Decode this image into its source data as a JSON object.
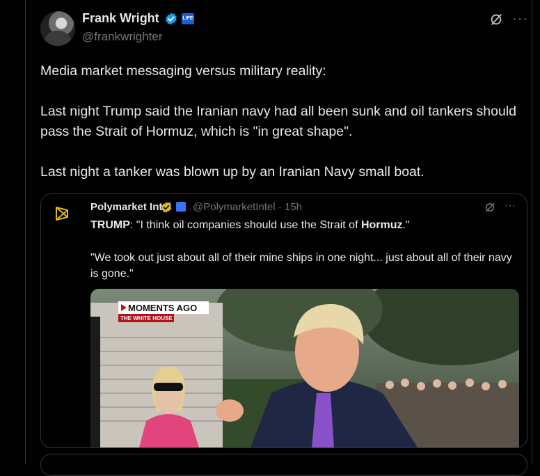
{
  "tweet": {
    "author": {
      "name": "Frank Wright",
      "handle": "@frankwrighter",
      "verified": true,
      "affiliate_badge_text": "LIFE"
    },
    "text": [
      "Media market messaging versus military reality:",
      "Last night Trump said the Iranian navy had all been sunk and oil tankers should pass the Strait of Hormuz, which is \"in great shape\".",
      "Last night a tanker was blown up by an Iranian Navy small boat."
    ]
  },
  "quote": {
    "author": {
      "name": "Polymarket Intel",
      "handle": "@PolymarketIntel",
      "separator": "·",
      "time": "15h"
    },
    "line1_prefix": "TRUMP",
    "line1_middle": ": \"I think oil companies should use the Strait of ",
    "line1_bold": "Hormuz",
    "line1_suffix": ".\"",
    "line2": "\"We took out just about all of their mine ships in one night... just about all of their navy is gone.\"",
    "media": {
      "banner": "MOMENTS AGO",
      "subbanner": "THE WHITE HOUSE"
    }
  },
  "colors": {
    "background": "#000000",
    "text": "#e7e9ea",
    "muted": "#71767b",
    "border": "#2f3336",
    "verified": "#1d9bf0",
    "gold_verified": "#e2b719",
    "banner_red": "#b3121a"
  },
  "icons": {
    "verified": "verified-badge-icon",
    "grok": "grok-icon",
    "more": "more-icon",
    "logo": "polymarket-logo-icon"
  }
}
